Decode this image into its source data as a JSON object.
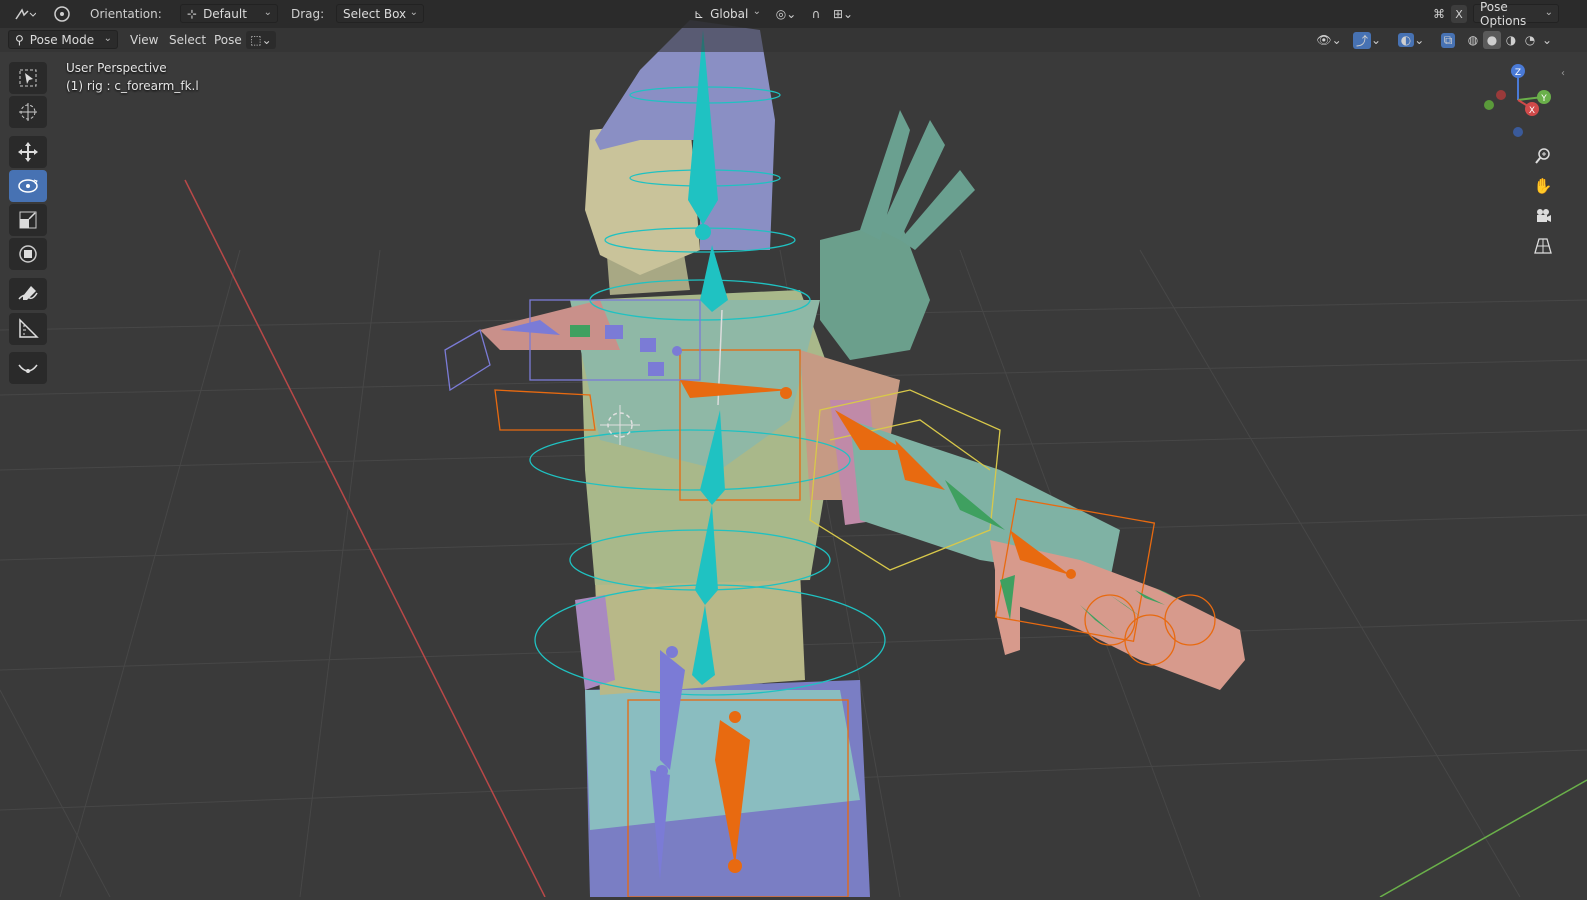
{
  "header": {
    "orientation_label": "Orientation:",
    "orientation_value": "Default",
    "drag_label": "Drag:",
    "drag_value": "Select Box",
    "transform_space": "Global",
    "pose_options": "Pose Options",
    "x_mirror": "X"
  },
  "subheader": {
    "mode": "Pose Mode",
    "menus": [
      "View",
      "Select",
      "Pose"
    ]
  },
  "overlay": {
    "view_name": "User Perspective",
    "active_object": "(1) rig : c_forearm_fk.l"
  },
  "toolbar": {
    "tools": [
      "select-box",
      "cursor",
      "move",
      "rotate",
      "scale",
      "transform",
      "annotate",
      "measure",
      "relax-pose"
    ],
    "active_tool": "rotate"
  },
  "gizmo": {
    "axes": [
      "X",
      "Y",
      "Z"
    ]
  },
  "colors": {
    "header_bg": "#2a2a2a",
    "viewport_bg": "#3a3a3a",
    "accent": "#4772b3",
    "bone_cyan": "#1fc2c2",
    "bone_orange": "#e86a10",
    "bone_purple": "#7b7bd6",
    "bone_green": "#3fa060",
    "x_axis": "#d04a4a",
    "y_axis": "#6ab04a",
    "z_axis": "#4a7ad6"
  }
}
